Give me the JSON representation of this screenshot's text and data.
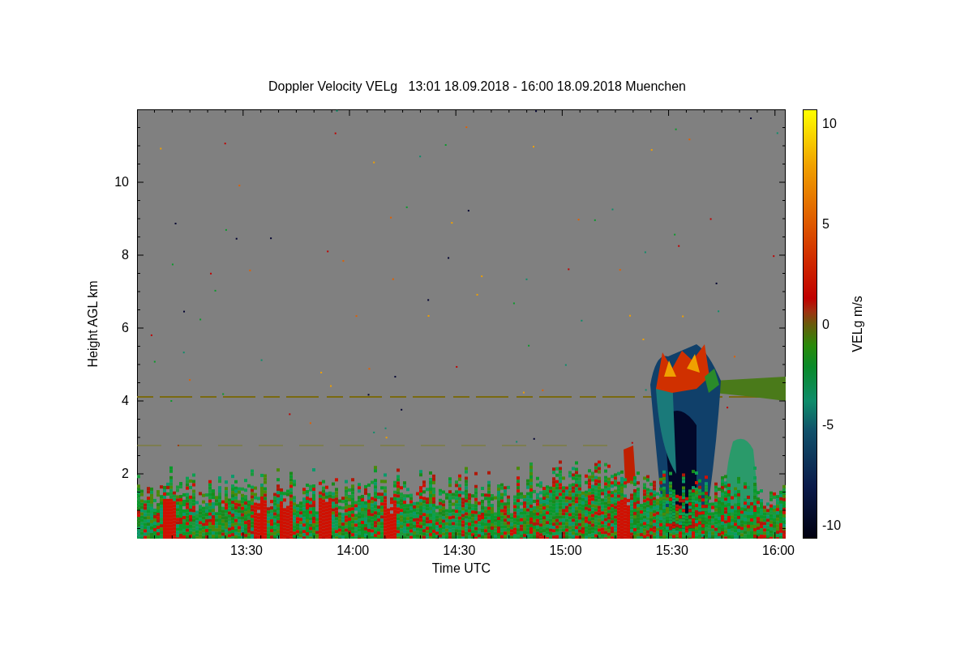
{
  "title": "Doppler Velocity VELg   13:01 18.09.2018 - 16:00 18.09.2018 Muenchen",
  "y_axis": {
    "label": "Height AGL km",
    "ticks": [
      "10",
      "8",
      "6",
      "4",
      "2"
    ]
  },
  "x_axis": {
    "label": "Time UTC",
    "ticks": [
      "13:30",
      "14:00",
      "14:30",
      "15:00",
      "15:30",
      "16:00"
    ]
  },
  "colorbar": {
    "label": "VELg m/s",
    "ticks": [
      "10",
      "5",
      "0",
      "-5",
      "-10"
    ]
  }
}
